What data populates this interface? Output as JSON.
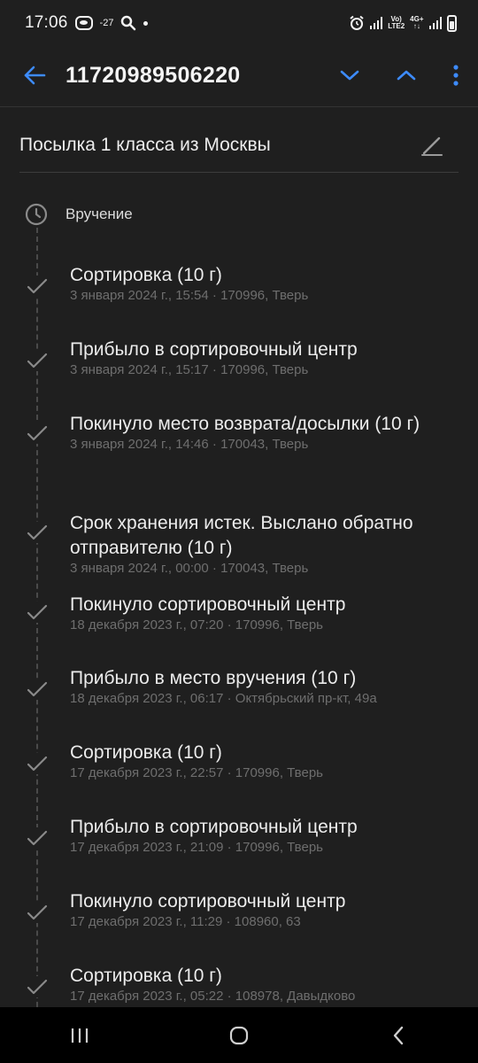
{
  "status_bar": {
    "time": "17:06",
    "temp": "-27",
    "net_top": "Vo)",
    "net_bottom": "LTE2",
    "net2_top": "4G+",
    "net2_bottom": "↑↓"
  },
  "header": {
    "tracking_number": "11720989506220"
  },
  "parcel": {
    "name": "Посылка 1 класса из Москвы"
  },
  "next_step": {
    "label": "Вручение"
  },
  "events": [
    {
      "title": "Сортировка (10 г)",
      "detail": "3 января 2024 г., 15:54 · 170996, Тверь"
    },
    {
      "title": "Прибыло в сортировочный центр",
      "detail": "3 января 2024 г., 15:17 · 170996, Тверь"
    },
    {
      "title": "Покинуло место возврата/досылки (10 г)",
      "detail": "3 января 2024 г., 14:46 · 170043, Тверь"
    },
    {
      "title": "Срок хранения истек. Выслано обратно отправителю (10 г)",
      "detail": "3 января 2024 г., 00:00 · 170043, Тверь"
    },
    {
      "title": "Покинуло сортировочный центр",
      "detail": "18 декабря 2023 г., 07:20 · 170996, Тверь"
    },
    {
      "title": "Прибыло в место вручения (10 г)",
      "detail": "18 декабря 2023 г., 06:17 · Октябрьский пр-кт, 49а"
    },
    {
      "title": "Сортировка (10 г)",
      "detail": "17 декабря 2023 г., 22:57 · 170996, Тверь"
    },
    {
      "title": "Прибыло в сортировочный центр",
      "detail": "17 декабря 2023 г., 21:09 · 170996, Тверь"
    },
    {
      "title": "Покинуло сортировочный центр",
      "detail": "17 декабря 2023 г., 11:29 · 108960, 63"
    },
    {
      "title": "Сортировка (10 г)",
      "detail": "17 декабря 2023 г., 05:22 · 108978, Давыдково"
    }
  ],
  "icons": {
    "back": "arrow-left-icon",
    "down": "chevron-down-icon",
    "up": "chevron-up-icon",
    "menu": "more-vertical-icon",
    "edit": "pencil-icon",
    "pending": "clock-icon",
    "done": "check-icon"
  },
  "colors": {
    "background": "#1f1f1f",
    "accent": "#3d8bfd",
    "secondary_text": "#6e6e6e"
  }
}
